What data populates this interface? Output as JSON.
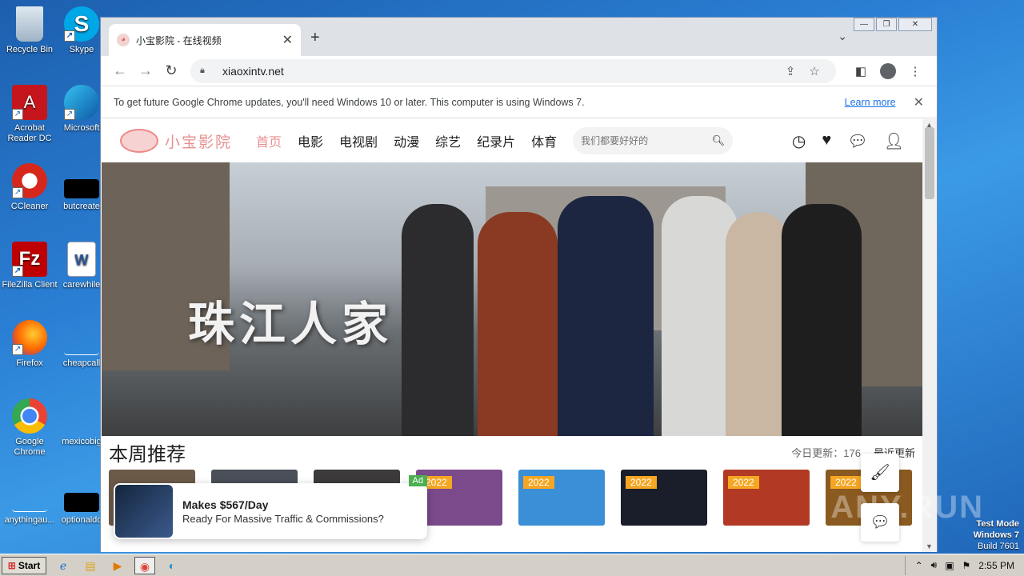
{
  "desktop": {
    "icons": [
      {
        "label": "Recycle Bin",
        "icon": "recycle-bin-icon"
      },
      {
        "label": "Skype",
        "icon": "skype-icon"
      },
      {
        "label": "Acrobat Reader DC",
        "icon": "acrobat-icon"
      },
      {
        "label": "Microsoft",
        "icon": "edge-icon"
      },
      {
        "label": "CCleaner",
        "icon": "ccleaner-icon"
      },
      {
        "label": "butcreate",
        "icon": "file-icon"
      },
      {
        "label": "FileZilla Client",
        "icon": "filezilla-icon"
      },
      {
        "label": "carewhile",
        "icon": "word-doc-icon"
      },
      {
        "label": "Firefox",
        "icon": "firefox-icon"
      },
      {
        "label": "cheapcall",
        "icon": "file-icon"
      },
      {
        "label": "Google Chrome",
        "icon": "chrome-icon"
      },
      {
        "label": "mexicobig",
        "icon": "file-icon"
      },
      {
        "label": "anythingau...",
        "icon": "file-icon"
      },
      {
        "label": "optionaldo",
        "icon": "file-icon"
      }
    ]
  },
  "browser": {
    "tab_title": "小宝影院 - 在线视频",
    "url": "xiaoxintv.net",
    "infobar_message": "To get future Google Chrome updates, you'll need Windows 10 or later. This computer is using Windows 7.",
    "infobar_link": "Learn more"
  },
  "site": {
    "logo_text": "小宝影院",
    "nav": [
      "首页",
      "电影",
      "电视剧",
      "动漫",
      "综艺",
      "纪录片",
      "体育"
    ],
    "search_placeholder": "我们都要好好的",
    "banner_title": "珠江人家",
    "section_title": "本周推荐",
    "updates_text": "今日更新：176",
    "more_text": "最近更新",
    "thumbnails": [
      {
        "badge": "",
        "color": "#6b5a48"
      },
      {
        "badge": "",
        "color": "#4a4f58"
      },
      {
        "badge": "",
        "color": "#3c3a3a"
      },
      {
        "badge": "2022",
        "color": "#7a4a8a"
      },
      {
        "badge": "2022",
        "color": "#3b8fd6"
      },
      {
        "badge": "2022",
        "color": "#1a1d2a"
      },
      {
        "badge": "2022",
        "color": "#b23a24"
      },
      {
        "badge": "2022",
        "color": "#8a5a20"
      }
    ]
  },
  "ad": {
    "label": "Ad",
    "title": "Makes $567/Day",
    "subtitle": "Ready For Massive Traffic & Commissions?"
  },
  "taskbar": {
    "start_label": "Start",
    "clock": "2:55 PM"
  },
  "watermark": {
    "line1": "Test Mode",
    "line2": "Windows 7",
    "line3": "Build 7601",
    "brand": "ANY.RUN"
  }
}
